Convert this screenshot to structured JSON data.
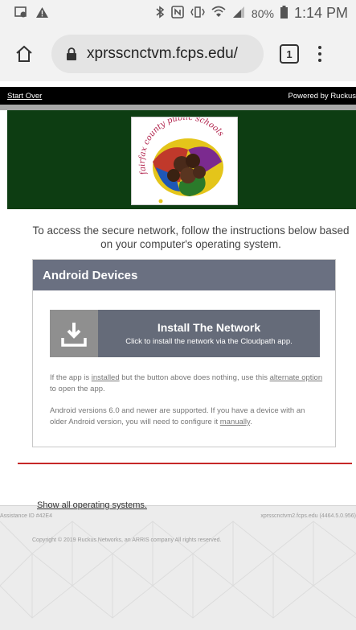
{
  "status_bar": {
    "battery": "80%",
    "time": "1:14 PM",
    "icons": [
      "photo-icon",
      "warning-icon",
      "bluetooth-icon",
      "nfc-icon",
      "vibrate-icon",
      "wifi-icon",
      "signal-icon",
      "battery-icon"
    ]
  },
  "browser": {
    "url": "xprsscnctvm.fcps.edu/",
    "tab_count": "1"
  },
  "topnav": {
    "start_over": "Start Over",
    "powered_by": "Powered by Ruckus"
  },
  "header": {
    "logo_text": "fairfax county public schools",
    "bg_color": "#0d3d12"
  },
  "intro": "To access the secure network, follow the instructions below based on your computer's operating system.",
  "panel": {
    "title": "Android Devices",
    "install_title": "Install The Network",
    "install_sub": "Click to install the network via the Cloudpath app.",
    "p1_a": "If the app is ",
    "p1_link1": "installed",
    "p1_b": " but the button above does nothing, use this ",
    "p1_link2": "alternate option",
    "p1_c": " to open the app.",
    "p2_a": "Android versions 6.0 and newer are supported. If you have a device with an older Android version, you will need to configure it ",
    "p2_link": "manually",
    "p2_b": "."
  },
  "show_all": "Show all operating systems.",
  "footer": {
    "assistance": "Assistance ID #42E4",
    "host": "xprsscnctvm2.fcps.edu (4464.5.0.956)",
    "copyright": "Copyright © 2019 Ruckus Networks, an ARRIS company All rights reserved."
  },
  "colors": {
    "panel_head": "#6a7081",
    "install_button": "#656b79",
    "divider": "#c62828"
  }
}
